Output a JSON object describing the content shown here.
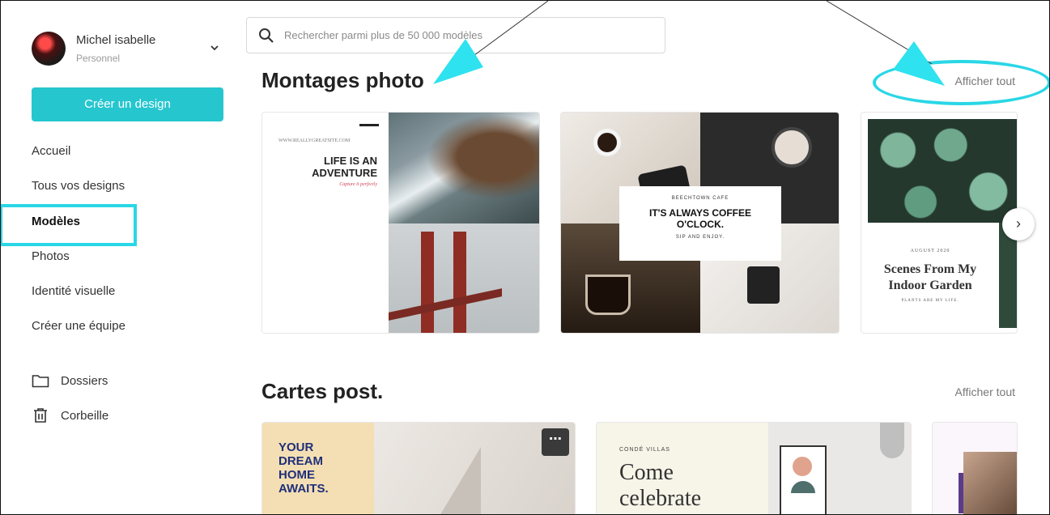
{
  "user": {
    "name": "Michel isabelle",
    "account_type": "Personnel"
  },
  "sidebar": {
    "create_label": "Créer un design",
    "items": [
      {
        "label": "Accueil"
      },
      {
        "label": "Tous vos designs"
      },
      {
        "label": "Modèles"
      },
      {
        "label": "Photos"
      },
      {
        "label": "Identité visuelle"
      },
      {
        "label": "Créer une équipe"
      }
    ],
    "folders": [
      {
        "label": "Dossiers",
        "icon": "folder-icon"
      },
      {
        "label": "Corbeille",
        "icon": "trash-icon"
      }
    ]
  },
  "search": {
    "placeholder": "Rechercher parmi plus de 50 000 modèles"
  },
  "sections": [
    {
      "title": "Montages photo",
      "see_all": "Afficher tout",
      "cards": [
        {
          "url": "WWW.REALLYGREATSITE.COM",
          "title_line1": "LIFE IS AN",
          "title_line2": "ADVENTURE",
          "subtitle": "Capture it perfectly"
        },
        {
          "kicker": "BEECHTOWN CAFE",
          "title_line1": "IT'S ALWAYS COFFEE",
          "title_line2": "O'CLOCK.",
          "subtitle": "SIP AND ENJOY."
        },
        {
          "kicker": "AUGUST 2020",
          "title_line1": "Scenes From My",
          "title_line2": "Indoor Garden",
          "subtitle": "PLANTS ARE MY LIFE."
        }
      ]
    },
    {
      "title": "Cartes post.",
      "see_all": "Afficher tout",
      "cards": [
        {
          "line1": "YOUR",
          "line2": "DREAM",
          "line3": "HOME",
          "line4": "AWAITS."
        },
        {
          "kicker": "CONDÉ VILLAS",
          "line1": "Come",
          "line2": "celebrate"
        },
        {}
      ]
    }
  ],
  "colors": {
    "accent": "#26c6cf",
    "annotation": "#29d7e6"
  }
}
